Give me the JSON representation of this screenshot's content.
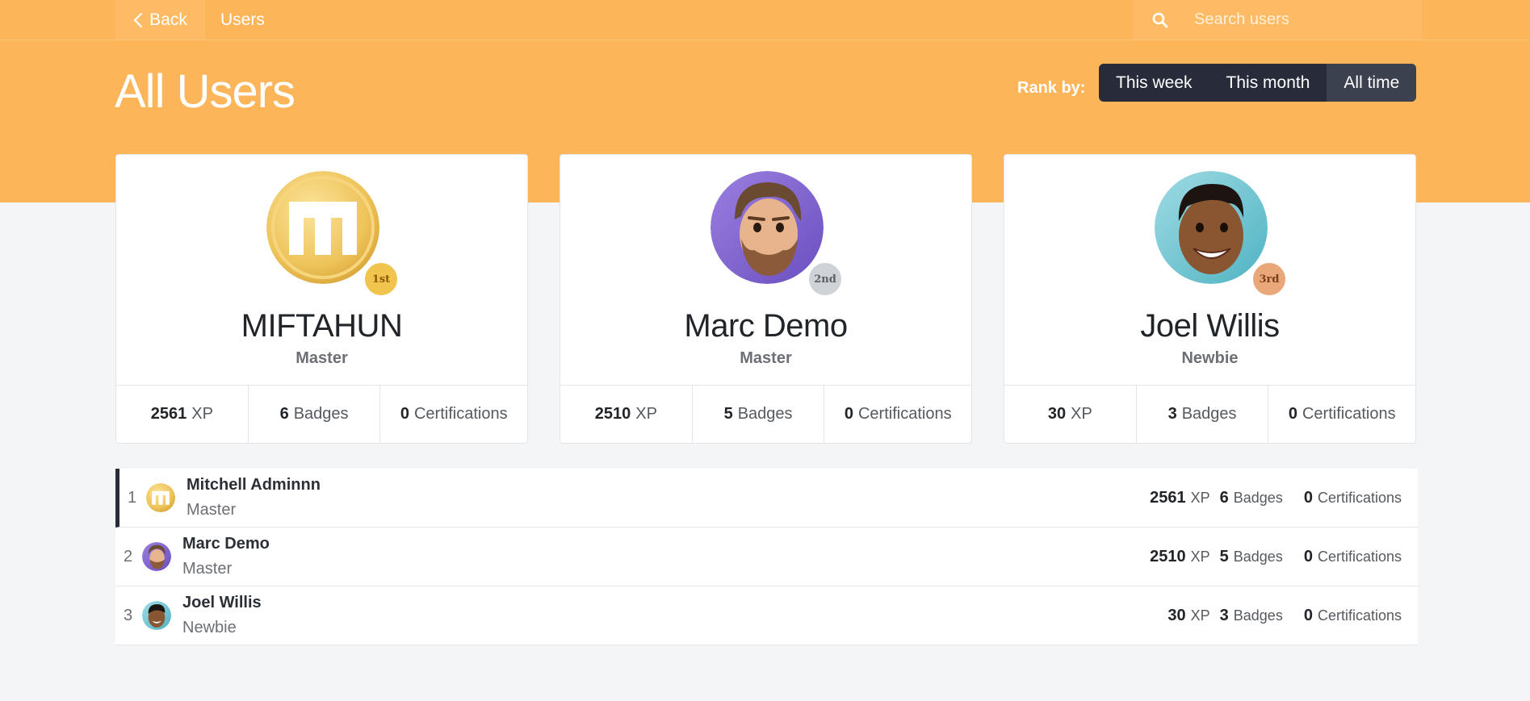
{
  "topbar": {
    "back_label": "Back",
    "breadcrumb": "Users",
    "search_placeholder": "Search users"
  },
  "header": {
    "title": "All Users",
    "rank_by_label": "Rank by:",
    "rank_options": [
      "This week",
      "This month",
      "All time"
    ],
    "active_option": "All time"
  },
  "stat_labels": {
    "xp": "XP",
    "badges": "Badges",
    "certifications": "Certifications"
  },
  "podium": [
    {
      "name": "MIFTAHUN",
      "rank": "Master",
      "medal": "1st",
      "xp": "2561",
      "badges": "6",
      "certifications": "0"
    },
    {
      "name": "Marc Demo",
      "rank": "Master",
      "medal": "2nd",
      "xp": "2510",
      "badges": "5",
      "certifications": "0"
    },
    {
      "name": "Joel Willis",
      "rank": "Newbie",
      "medal": "3rd",
      "xp": "30",
      "badges": "3",
      "certifications": "0"
    }
  ],
  "leaderboard": [
    {
      "position": "1",
      "name": "Mitchell Adminnn",
      "rank": "Master",
      "xp": "2561",
      "badges": "6",
      "certifications": "0"
    },
    {
      "position": "2",
      "name": "Marc Demo",
      "rank": "Master",
      "xp": "2510",
      "badges": "5",
      "certifications": "0"
    },
    {
      "position": "3",
      "name": "Joel Willis",
      "rank": "Newbie",
      "xp": "30",
      "badges": "3",
      "certifications": "0"
    }
  ],
  "colors": {
    "hero": "#fdb55a",
    "dark": "#282c3a",
    "gold": "#f1c44d",
    "silver": "#cfd3d8",
    "bronze": "#e9a77a"
  }
}
